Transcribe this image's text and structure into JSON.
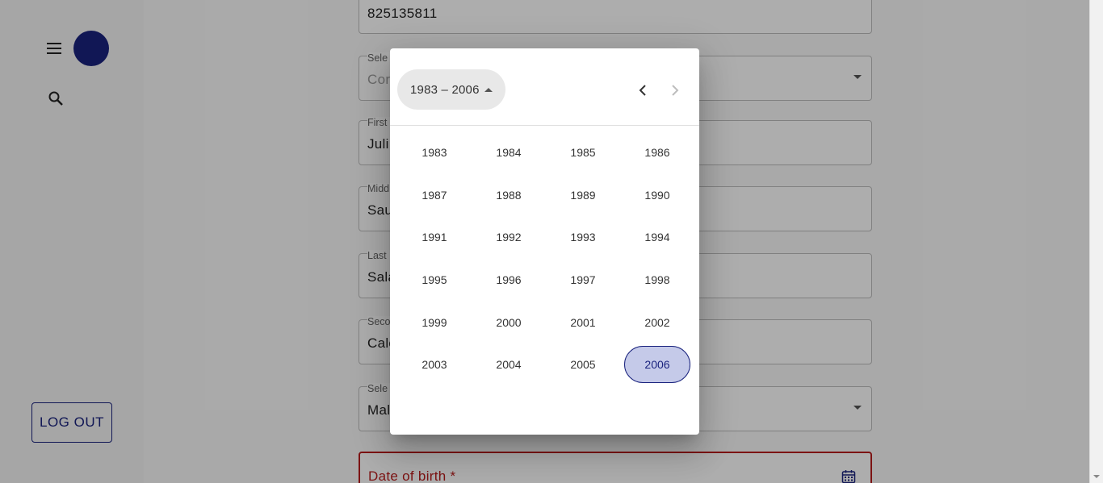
{
  "sidebar": {
    "logout_label": "LOG OUT"
  },
  "form": {
    "phone_value": "825135811",
    "select_country_label": "Sele",
    "select_country_value": "Cor",
    "first_name_label": "First",
    "first_name_value": "Juli",
    "middle_name_label": "Midd",
    "middle_name_value": "Sau",
    "last_name_label": "Last",
    "last_name_value": "Sala",
    "second_last_name_label": "Seco",
    "second_last_name_value": "Calc",
    "select_gender_label": "Sele",
    "select_gender_value": "Mal",
    "dob_label": "Date of birth *"
  },
  "datepicker": {
    "period_label": "1983 – 2006",
    "years": [
      "1983",
      "1984",
      "1985",
      "1986",
      "1987",
      "1988",
      "1989",
      "1990",
      "1991",
      "1992",
      "1993",
      "1994",
      "1995",
      "1996",
      "1997",
      "1998",
      "1999",
      "2000",
      "2001",
      "2002",
      "2003",
      "2004",
      "2005",
      "2006"
    ],
    "selected_year": "2006"
  },
  "colors": {
    "primary": "#1a237e",
    "selected_bg": "#c5cae9",
    "error": "#b71c1c"
  },
  "icons": [
    "menu-icon",
    "search-icon",
    "calendar-icon",
    "chevron-left-icon",
    "chevron-right-icon"
  ]
}
